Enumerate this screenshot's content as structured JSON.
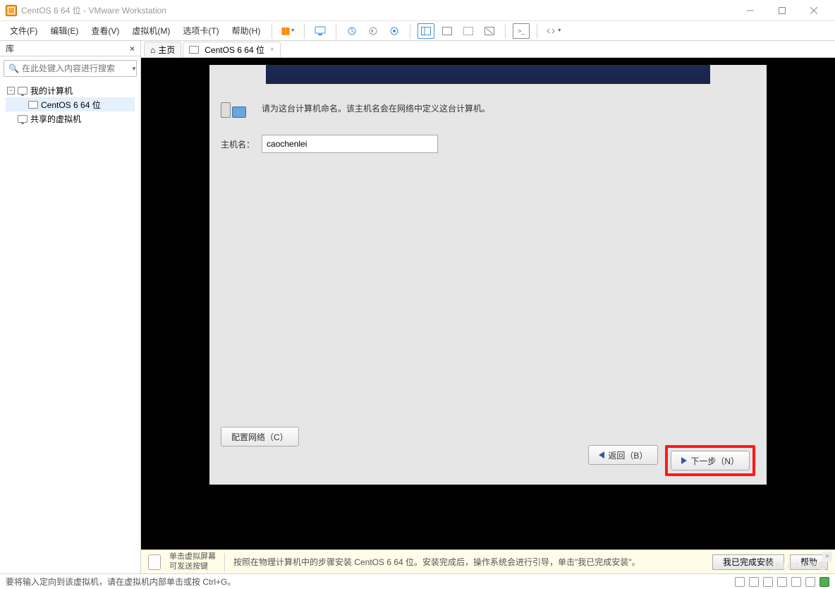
{
  "window": {
    "title": "CentOS 6 64 位 - VMware Workstation"
  },
  "menu": {
    "file": "文件(F)",
    "edit": "编辑(E)",
    "view": "查看(V)",
    "vm": "虚拟机(M)",
    "tabs": "选项卡(T)",
    "help": "帮助(H)"
  },
  "sidebar": {
    "title": "库",
    "search_placeholder": "在此处键入内容进行搜索",
    "tree": {
      "root": "我的计算机",
      "child": "CentOS 6 64 位",
      "shared": "共享的虚拟机"
    }
  },
  "tabs": {
    "home": "主页",
    "active": "CentOS 6 64 位"
  },
  "installer": {
    "description": "请为这台计算机命名。该主机名会在网络中定义这台计算机。",
    "hostname_label": "主机名：",
    "hostname_value": "caochenlei",
    "configure_network": "配置网络（C）",
    "back": "返回（B）",
    "next": "下一步（N）"
  },
  "infobar": {
    "note_line1": "单击虚拟屏幕",
    "note_line2": "可发送按键",
    "message": "按照在物理计算机中的步骤安装 CentOS 6 64 位。安装完成后，操作系统会进行引导，单击\"我已完成安装\"。",
    "done_btn": "我已完成安装",
    "help_btn": "帮助"
  },
  "statusbar": {
    "text": "要将输入定向到该虚拟机，请在虚拟机内部单击或按 Ctrl+G。"
  },
  "watermark": "@51CTO博客"
}
